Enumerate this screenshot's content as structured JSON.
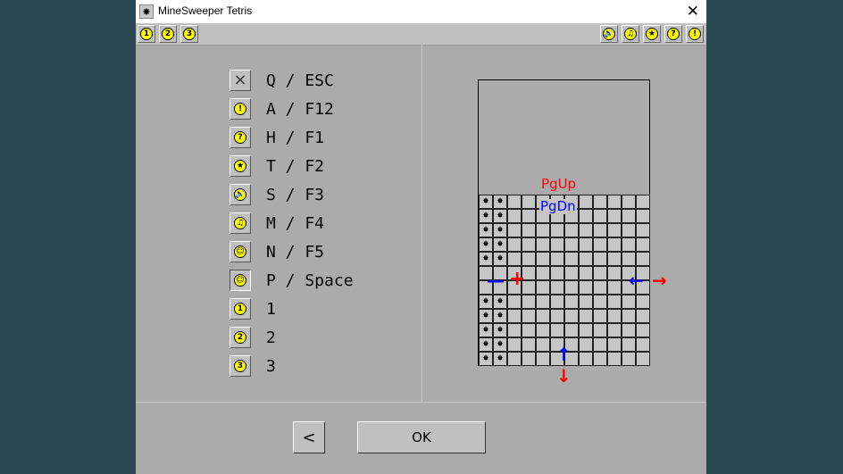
{
  "window": {
    "title": "MineSweeper Tetris",
    "close_glyph": "✕",
    "app_icon_glyph": "✸"
  },
  "toolbar": {
    "left": [
      {
        "glyph": "1",
        "name": "level-1"
      },
      {
        "glyph": "2",
        "name": "level-2"
      },
      {
        "glyph": "3",
        "name": "level-3"
      }
    ],
    "right": [
      {
        "glyph": "🔊",
        "name": "sound-icon"
      },
      {
        "glyph": "♫",
        "name": "music-icon"
      },
      {
        "glyph": "★",
        "name": "star-icon"
      },
      {
        "glyph": "?",
        "name": "help-icon"
      },
      {
        "glyph": "!",
        "name": "info-icon"
      }
    ]
  },
  "shortcuts": [
    {
      "icon": "×",
      "icon_name": "close-icon",
      "label": "Q / ESC",
      "plain": true
    },
    {
      "icon": "!",
      "icon_name": "info-icon",
      "label": "A / F12"
    },
    {
      "icon": "?",
      "icon_name": "help-icon",
      "label": "H / F1"
    },
    {
      "icon": "★",
      "icon_name": "star-icon",
      "label": "T / F2"
    },
    {
      "icon": "🔊",
      "icon_name": "sound-icon",
      "label": "S / F3"
    },
    {
      "icon": "♫",
      "icon_name": "music-icon",
      "label": "M / F4"
    },
    {
      "icon": "☺",
      "icon_name": "smiley-icon",
      "label": "N / F5"
    },
    {
      "icon": "☺",
      "icon_name": "smiley-icon",
      "label": "P / Space",
      "pressed": true
    },
    {
      "icon": "1",
      "icon_name": "level-1-icon",
      "label": "1"
    },
    {
      "icon": "2",
      "icon_name": "level-2-icon",
      "label": "2"
    },
    {
      "icon": "3",
      "icon_name": "level-3-icon",
      "label": "3"
    }
  ],
  "diagram": {
    "pgup": "PgUp",
    "pgdn": "PgDn",
    "minus": "—",
    "plus": "+",
    "left_arrow": "←",
    "right_arrow": "→",
    "up_arrow": "↑",
    "down_arrow": "↓",
    "mine_glyph": "✸",
    "colors": {
      "red": "#ff0000",
      "blue": "#0000ff"
    }
  },
  "buttons": {
    "back": "<",
    "ok": "OK"
  }
}
